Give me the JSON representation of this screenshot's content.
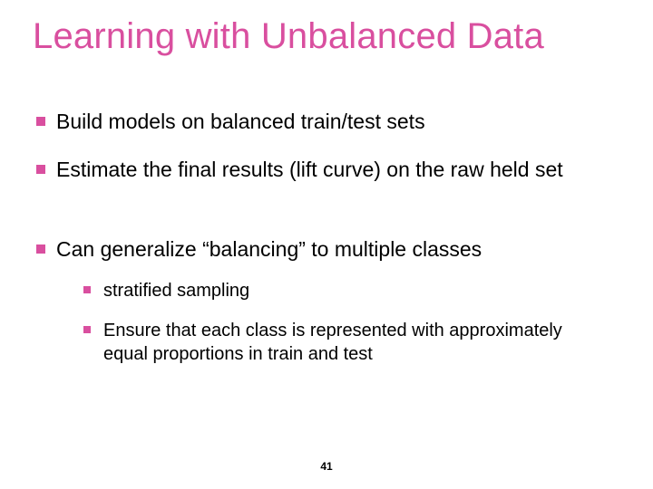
{
  "title": "Learning with Unbalanced Data",
  "bullets": [
    {
      "text": "Build models on balanced train/test sets"
    },
    {
      "text": "Estimate the final results (lift curve) on the raw held set"
    },
    {
      "text": "Can generalize “balancing” to multiple classes",
      "sub": [
        "stratified sampling",
        "Ensure that each class is represented with approximately equal proportions in train and test"
      ]
    }
  ],
  "page_number": "41"
}
